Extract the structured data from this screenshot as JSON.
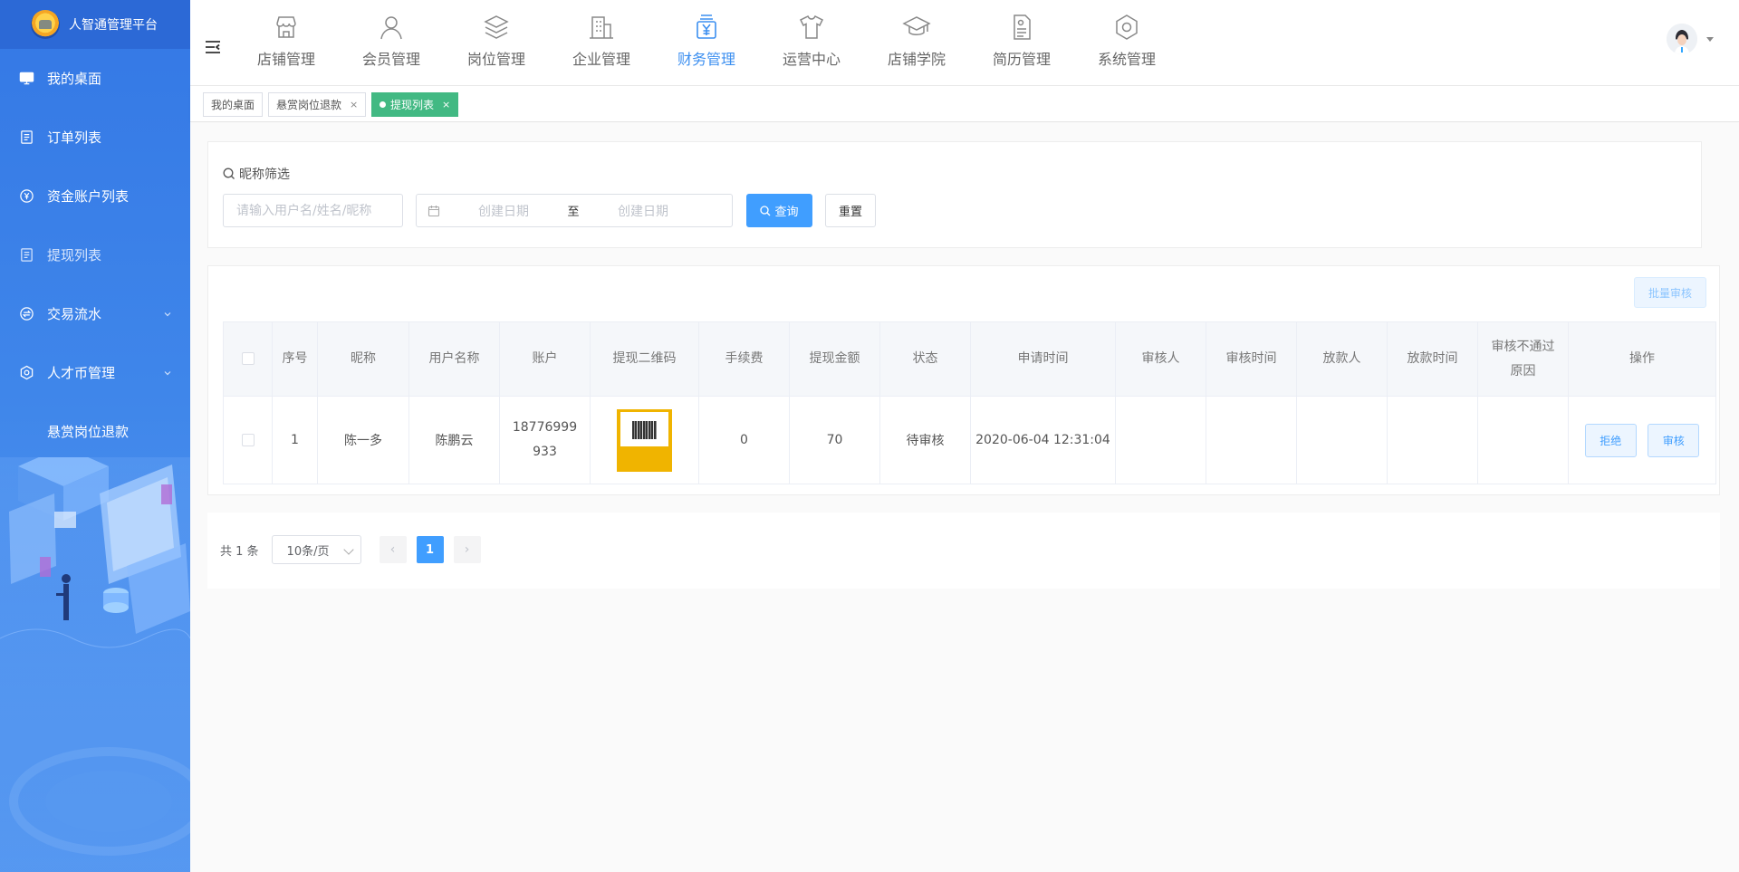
{
  "app": {
    "title": "人智通管理平台"
  },
  "sidebar": {
    "items": [
      {
        "label": "我的桌面",
        "icon": "monitor-icon"
      },
      {
        "label": "订单列表",
        "icon": "document-icon"
      },
      {
        "label": "资金账户列表",
        "icon": "yen-coin-icon"
      },
      {
        "label": "提现列表",
        "icon": "document-icon"
      },
      {
        "label": "交易流水",
        "icon": "exchange-icon"
      },
      {
        "label": "人才币管理",
        "icon": "settings-shield-icon"
      },
      {
        "label": "悬赏岗位退款",
        "icon": ""
      }
    ]
  },
  "topnav": {
    "tabs": [
      {
        "label": "店铺管理",
        "icon": "store-icon"
      },
      {
        "label": "会员管理",
        "icon": "user-icon"
      },
      {
        "label": "岗位管理",
        "icon": "layers-icon"
      },
      {
        "label": "企业管理",
        "icon": "building-icon"
      },
      {
        "label": "财务管理",
        "icon": "finance-icon"
      },
      {
        "label": "运营中心",
        "icon": "shirt-icon"
      },
      {
        "label": "店铺学院",
        "icon": "graduation-cap-icon"
      },
      {
        "label": "简历管理",
        "icon": "resume-icon"
      },
      {
        "label": "系统管理",
        "icon": "gear-icon"
      }
    ],
    "active_tab": "财务管理"
  },
  "tags": [
    {
      "label": "我的桌面"
    },
    {
      "label": "悬赏岗位退款",
      "close": "×"
    },
    {
      "label": "提现列表",
      "close": "×",
      "active": true
    }
  ],
  "filter": {
    "title": "昵称筛选",
    "search_placeholder": "请输入用户名/姓名/昵称",
    "date_start_placeholder": "创建日期",
    "date_separator": "至",
    "date_end_placeholder": "创建日期",
    "query_label": "查询",
    "reset_label": "重置"
  },
  "table": {
    "batch_label": "批量审核",
    "headers": [
      "序号",
      "昵称",
      "用户名称",
      "账户",
      "提现二维码",
      "手续费",
      "提现金额",
      "状态",
      "申请时间",
      "审核人",
      "审核时间",
      "放款人",
      "放款时间",
      "审核不通过原因",
      "操作"
    ],
    "rows": [
      {
        "index": "1",
        "nickname": "陈一多",
        "username": "陈鹏云",
        "account": "18776999933",
        "fee": "0",
        "amount": "70",
        "status": "待审核",
        "apply_time": "2020-06-04 12:31:04",
        "reviewer": "",
        "review_time": "",
        "payer": "",
        "pay_time": "",
        "reject_reason": "",
        "reject_label": "拒绝",
        "approve_label": "审核"
      }
    ]
  },
  "pagination": {
    "total_text": "共 1 条",
    "page_size": "10条/页",
    "current_page": "1",
    "prev": "‹",
    "next": "›"
  },
  "colors": {
    "sidebar_bg": "#3f86ea",
    "primary": "#409eff",
    "active_tab": "#3c8ff0",
    "active_tag": "#42b983",
    "qr_bg": "#f0b400"
  }
}
